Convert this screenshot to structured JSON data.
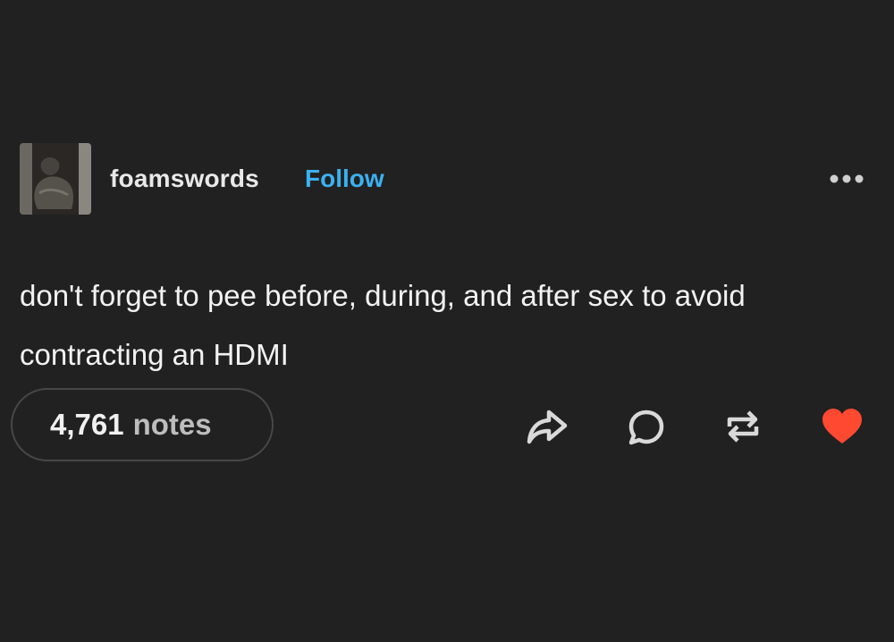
{
  "post": {
    "username": "foamswords",
    "follow_label": "Follow",
    "text": "don't forget to pee before, during, and after sex to avoid contracting an HDMI",
    "notes_count": "4,761",
    "notes_label": "notes"
  },
  "icons": {
    "more": "more-options-icon",
    "share": "share-icon",
    "reply": "reply-icon",
    "reblog": "reblog-icon",
    "like": "like-icon"
  },
  "colors": {
    "background": "#212121",
    "follow_accent": "#3bb1f0",
    "like_active": "#ff4930"
  }
}
